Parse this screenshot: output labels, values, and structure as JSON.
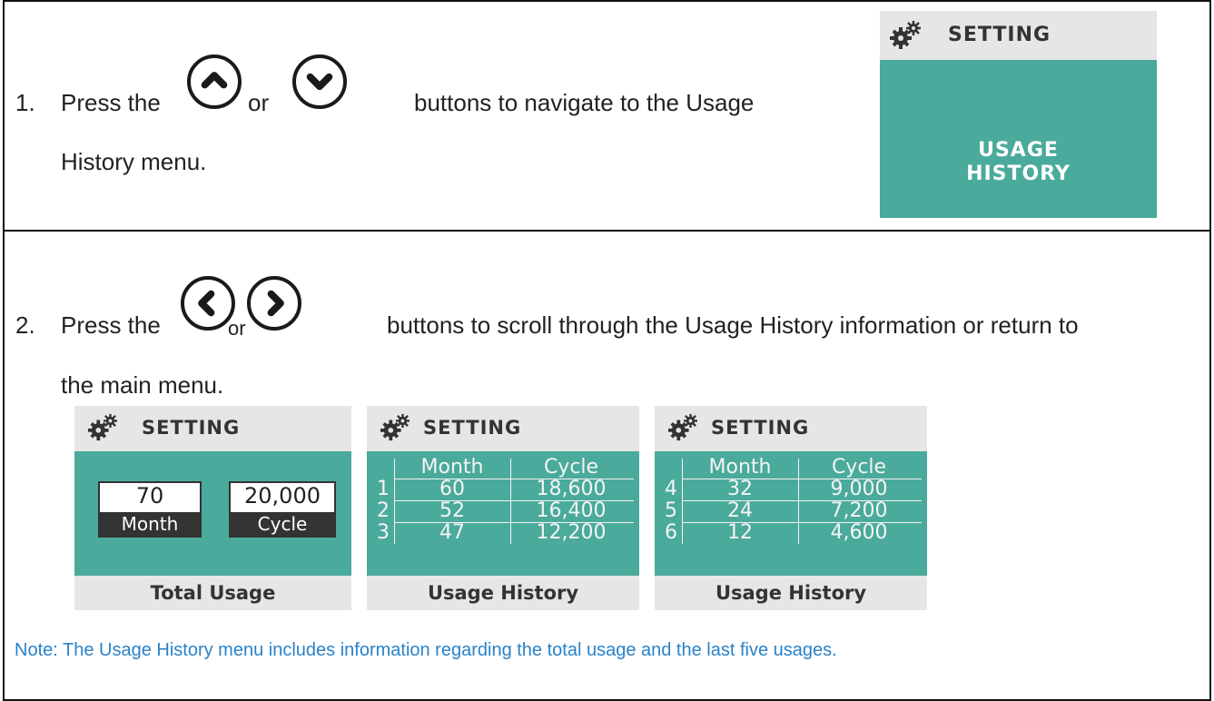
{
  "step1": {
    "number": "1.",
    "text_before": "Press the",
    "text_or": "or",
    "text_after": "buttons to navigate to the Usage",
    "text_line2": "History menu.",
    "buttons": [
      "chevron-up-icon",
      "chevron-down-icon"
    ]
  },
  "usage_history_panel": {
    "header": "SETTING",
    "body_line1": "USAGE",
    "body_line2": "HISTORY"
  },
  "step2": {
    "number": "2.",
    "text_before": "Press the",
    "text_or": "or",
    "text_after": "buttons to scroll through the Usage History information or return to",
    "text_line2": "the main menu.",
    "buttons": [
      "chevron-left-icon",
      "chevron-right-icon"
    ]
  },
  "total_panel": {
    "header": "SETTING",
    "month_value": "70",
    "month_label": "Month",
    "cycle_value": "20,000",
    "cycle_label": "Cycle",
    "footer": "Total Usage"
  },
  "history_panel_1": {
    "header": "SETTING",
    "col_month": "Month",
    "col_cycle": "Cycle",
    "rows": [
      {
        "index": "1",
        "month": "60",
        "cycle": "18,600"
      },
      {
        "index": "2",
        "month": "52",
        "cycle": "16,400"
      },
      {
        "index": "3",
        "month": "47",
        "cycle": "12,200"
      }
    ],
    "footer": "Usage History"
  },
  "history_panel_2": {
    "header": "SETTING",
    "col_month": "Month",
    "col_cycle": "Cycle",
    "rows": [
      {
        "index": "4",
        "month": "32",
        "cycle": "9,000"
      },
      {
        "index": "5",
        "month": "24",
        "cycle": "7,200"
      },
      {
        "index": "6",
        "month": "12",
        "cycle": "4,600"
      }
    ],
    "footer": "Usage History"
  },
  "note": "Note: The Usage History menu includes information regarding the total usage and the last five usages.",
  "colors": {
    "panel_teal": "#4aaa9b",
    "panel_grey": "#e6e6e6",
    "note_blue": "#2a82c8"
  }
}
